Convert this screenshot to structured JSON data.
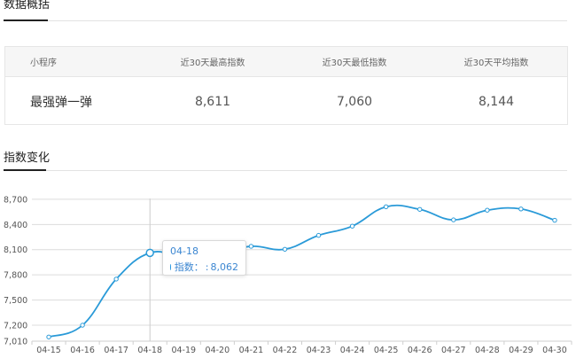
{
  "overview": {
    "title": "数据概括",
    "headers": [
      "小程序",
      "近30天最高指数",
      "近30天最低指数",
      "近30天平均指数"
    ],
    "row": [
      "最强弹一弹",
      "8,611",
      "7,060",
      "8,144"
    ]
  },
  "trend": {
    "title": "指数变化"
  },
  "tooltip": {
    "date": "04-18",
    "label": "指数：",
    "value": "8,062"
  },
  "colors": {
    "line": "#2a9ad8",
    "tooltip_text": "#3b86d1",
    "grid": "#dcdcdc"
  },
  "chart_data": {
    "type": "line",
    "categories": [
      "04-15",
      "04-16",
      "04-17",
      "04-18",
      "04-19",
      "04-20",
      "04-21",
      "04-22",
      "04-23",
      "04-24",
      "04-25",
      "04-26",
      "04-27",
      "04-28",
      "04-29",
      "04-30"
    ],
    "series": [
      {
        "name": "指数",
        "values": [
          7060,
          7200,
          7750,
          8062,
          8010,
          8045,
          8140,
          8105,
          8270,
          8380,
          8611,
          8580,
          8455,
          8570,
          8585,
          8450
        ]
      }
    ],
    "yticks": [
      7010,
      7200,
      7500,
      7800,
      8100,
      8400,
      8700
    ],
    "ytick_labels": [
      "7,010",
      "7,200",
      "7,500",
      "7,800",
      "8,100",
      "8,400",
      "8,700"
    ],
    "ylim": [
      7010,
      8910
    ],
    "highlight_index": 3,
    "grid": true,
    "title": "",
    "xlabel": "",
    "ylabel": ""
  }
}
